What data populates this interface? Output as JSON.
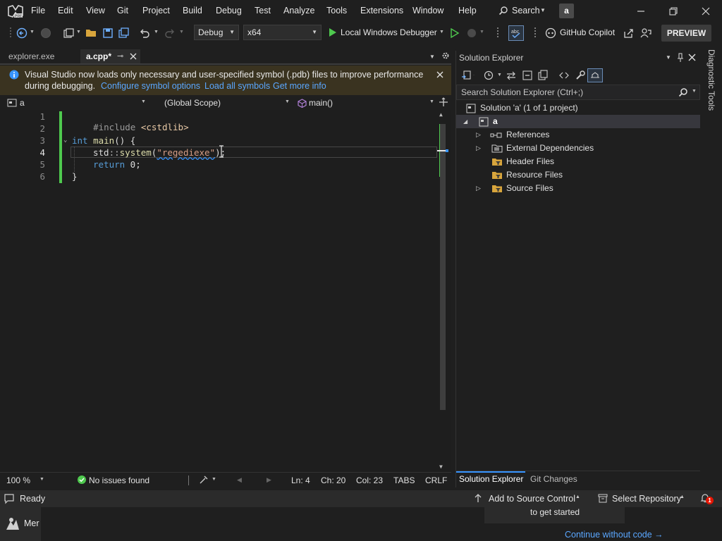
{
  "menubar": {
    "items": [
      "File",
      "Edit",
      "View",
      "Git",
      "Project",
      "Build",
      "Debug",
      "Test",
      "Analyze",
      "Tools",
      "Extensions",
      "Window",
      "Help"
    ],
    "search_label": "Search",
    "account_initial": "a"
  },
  "toolbar": {
    "configuration": "Debug",
    "platform": "x64",
    "debugger_label": "Local Windows Debugger",
    "copilot_label": "GitHub Copilot",
    "preview_label": "PREVIEW"
  },
  "tabs": [
    {
      "label": "explorer.exe",
      "active": false
    },
    {
      "label": "a.cpp*",
      "active": true
    }
  ],
  "infobar": {
    "message_line1": "Visual Studio now loads only necessary and user-specified symbol (.pdb) files to improve performance",
    "message_line2": "during debugging.",
    "link_configure": "Configure symbol options",
    "link_load": "Load all symbols",
    "link_more": "Get more info"
  },
  "navbar": {
    "project": "a",
    "scope": "(Global Scope)",
    "member": "main()"
  },
  "editor": {
    "line_numbers": [
      "1",
      "2",
      "3",
      "4",
      "5",
      "6"
    ],
    "line1": {
      "directive": "#include",
      "header": "<cstdlib>"
    },
    "line3": {
      "type": "int",
      "name": "main",
      "rest": "() {"
    },
    "line4": {
      "ns": "std",
      "sep": "::",
      "fn": "system",
      "open": "(",
      "str": "\"regediexe\"",
      "close": ");"
    },
    "line5": {
      "kw": "return",
      "rest": " 0;"
    },
    "line6": {
      "brace": "}"
    }
  },
  "editor_status": {
    "zoom": "100 %",
    "issues": "No issues found",
    "ln": "Ln: 4",
    "ch": "Ch: 20",
    "col": "Col: 23",
    "tabs": "TABS",
    "eol": "CRLF"
  },
  "solution_explorer": {
    "title": "Solution Explorer",
    "search_placeholder": "Search Solution Explorer (Ctrl+;)",
    "solution_label": "Solution 'a' (1 of 1 project)",
    "project_label": "a",
    "nodes": [
      "References",
      "External Dependencies",
      "Header Files",
      "Resource Files",
      "Source Files"
    ],
    "bottom_tabs": [
      "Solution Explorer",
      "Git Changes"
    ]
  },
  "diagnostic_tools_label": "Diagnostic Tools",
  "statusbar": {
    "ready": "Ready",
    "source_control": "Add to Source Control",
    "select_repo": "Select Repository",
    "notification_count": "1"
  },
  "bottom": {
    "get_started": "to get started",
    "continue": "Continue without code →",
    "taskbar_label": "Mer"
  },
  "colors": {
    "accent": "#3794ff",
    "green": "#4ec94e",
    "info": "#3794ff",
    "preview_bg": "#3c3c3c"
  }
}
